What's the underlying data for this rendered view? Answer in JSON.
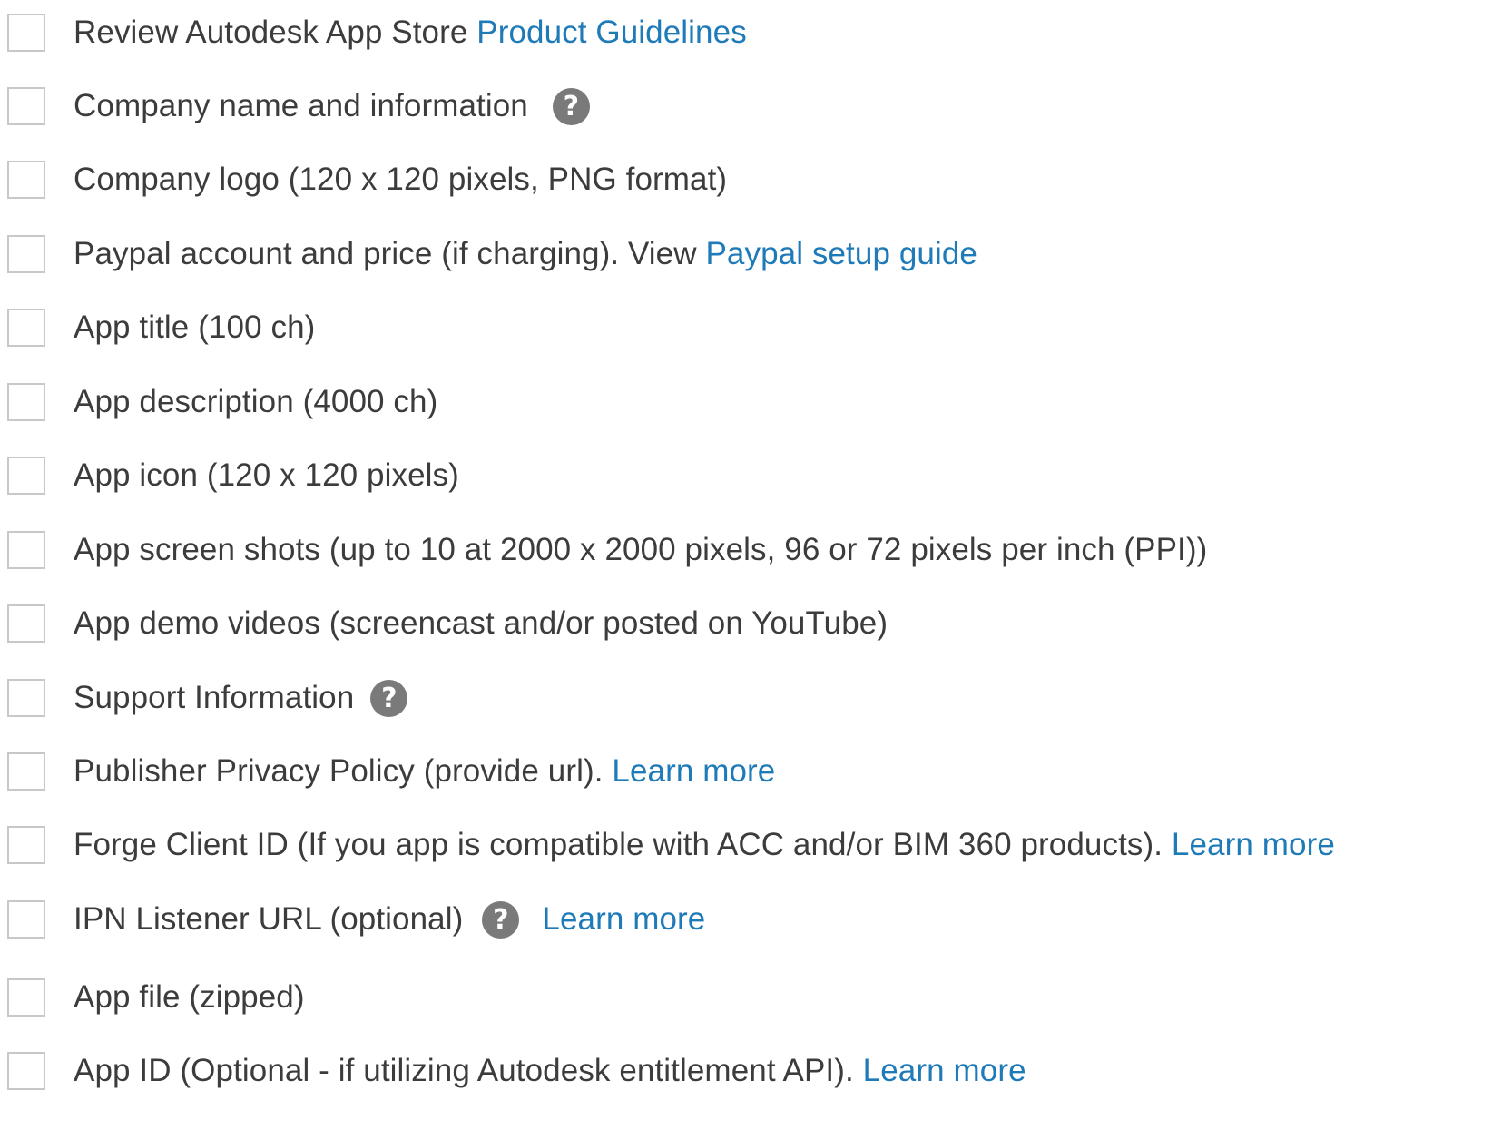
{
  "checklist": {
    "items": [
      {
        "text": "Review Autodesk App Store ",
        "link": "Product Guidelines"
      },
      {
        "text": "Company name and information",
        "help_icon": "question-circle-icon"
      },
      {
        "text": "Company logo (120 x 120 pixels, PNG format)"
      },
      {
        "text": "Paypal account and price (if charging). View ",
        "link": "Paypal setup guide"
      },
      {
        "text": "App title (100 ch)"
      },
      {
        "text": "App description (4000 ch)"
      },
      {
        "text": "App icon (120 x 120 pixels)"
      },
      {
        "text": "App screen shots (up to 10 at 2000 x 2000 pixels, 96 or 72 pixels per inch (PPI))"
      },
      {
        "text": "App demo videos (screencast and/or posted on YouTube)"
      },
      {
        "text": "Support Information",
        "help_icon": "question-circle-icon"
      },
      {
        "text": "Publisher Privacy Policy (provide url). ",
        "link": "Learn more"
      },
      {
        "text": "Forge Client ID (If you app is compatible with ACC and/or BIM 360 products). ",
        "link": "Learn more"
      },
      {
        "text": "IPN Listener URL (optional)",
        "help_icon": "question-circle-icon",
        "link": "Learn more"
      },
      {
        "text": "App file (zipped)"
      },
      {
        "text": "App ID (Optional - if utilizing Autodesk entitlement API). ",
        "link": "Learn more"
      }
    ]
  },
  "help_glyph": "?",
  "colors": {
    "text": "#3c3c3c",
    "link": "#1f7ab8",
    "checkbox_border": "#c8c8c8",
    "help_icon_bg": "#7a7a7a"
  }
}
